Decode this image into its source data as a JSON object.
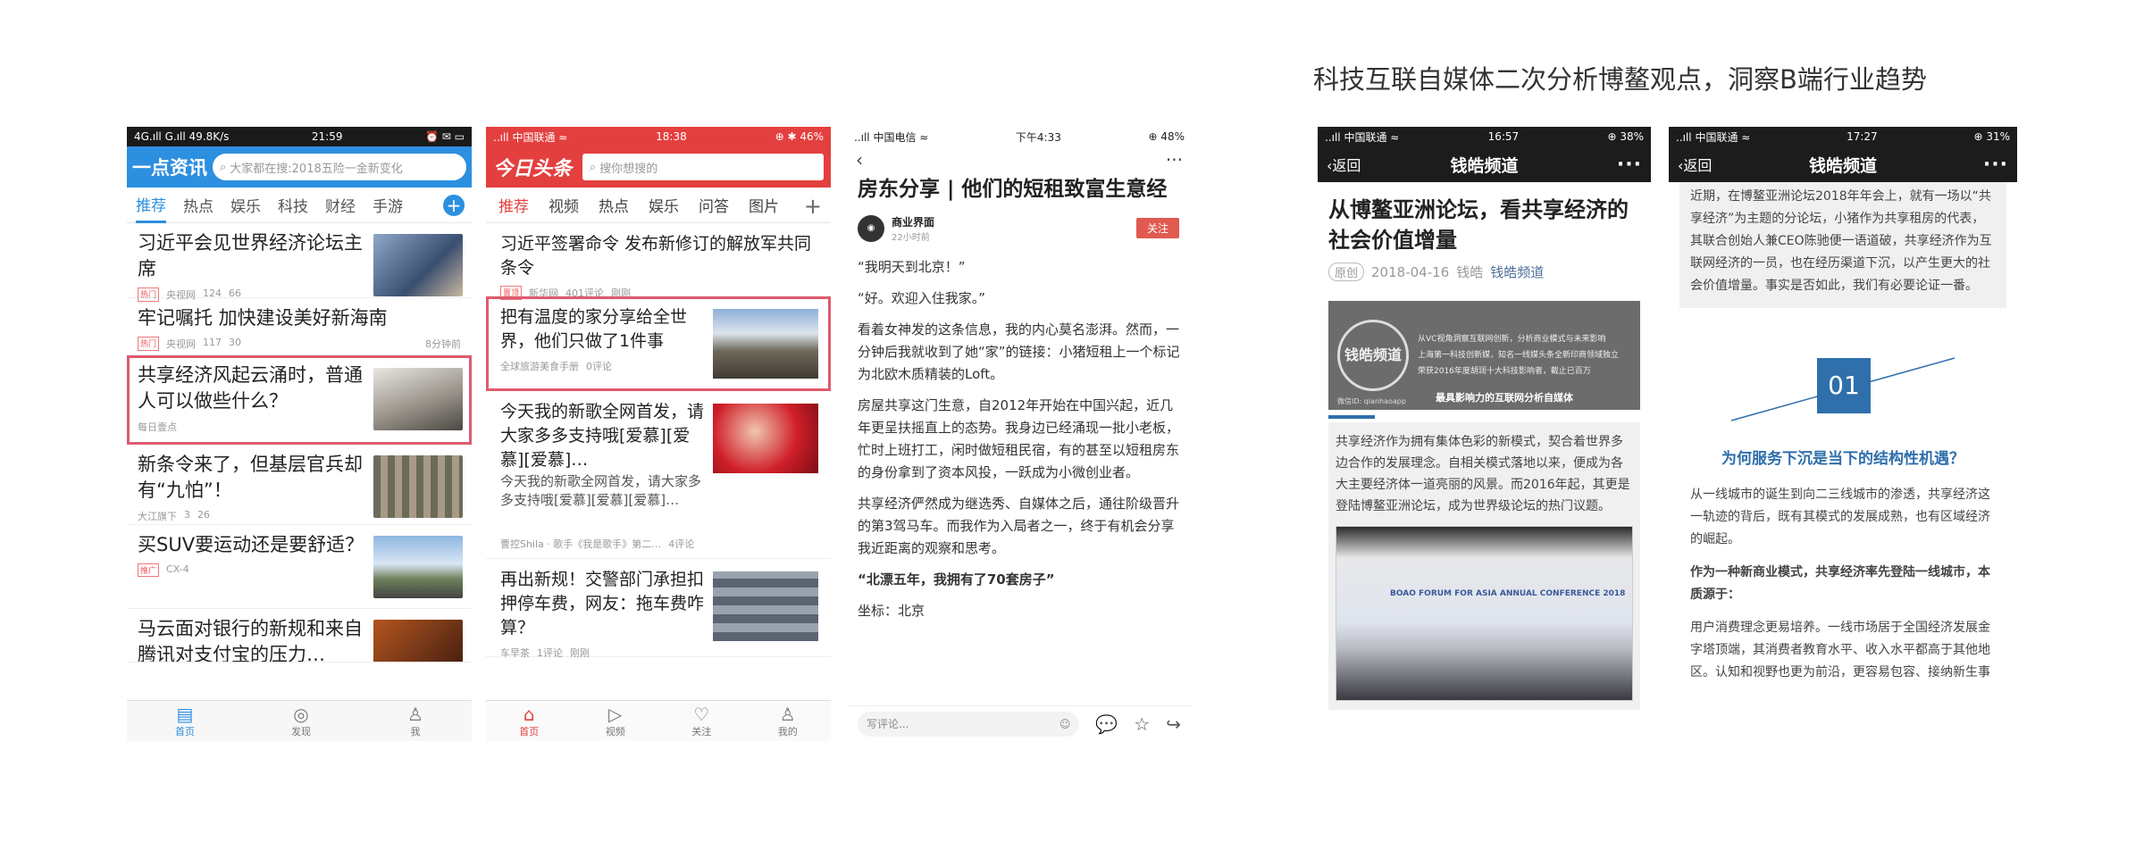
{
  "caption": "科技互联自媒体二次分析博鳌观点，洞察B端行业趋势",
  "colors": {
    "yidian_blue": "#2d8fe0",
    "toutiao_red": "#e43f3f",
    "highlight": "#e05a6e",
    "channel_blue": "#2f6fab"
  },
  "phone1": {
    "status": {
      "left": "4G.ıll G.ıll 49.8K/s",
      "time": "21:59",
      "right": "⏰ ✉ ▭"
    },
    "logo": "一点资讯",
    "search_placeholder": "大家都在搜:2018五险一金新变化",
    "tabs": [
      "推荐",
      "热点",
      "娱乐",
      "科技",
      "财经",
      "手游"
    ],
    "plus_icon": "plus-icon",
    "items": [
      {
        "title": "习近平会见世界经济论坛主席",
        "tag": "热门",
        "source": "央视网",
        "comments": "124",
        "likes": "66",
        "time": ""
      },
      {
        "title": "牢记嘱托 加快建设美好新海南",
        "tag": "热门",
        "source": "央视网",
        "comments": "117",
        "likes": "30",
        "time": "8分钟前"
      },
      {
        "title": "共享经济风起云涌时，普通人可以做些什么？",
        "tag": "",
        "source": "每日壹点",
        "comments": "",
        "likes": "",
        "time": ""
      },
      {
        "title": "新条令来了，但基层官兵却有“九怕”！",
        "tag": "",
        "source": "大江旗下",
        "comments": "3",
        "likes": "26",
        "time": ""
      },
      {
        "title": "买SUV要运动还是要舒适？",
        "tag": "推广",
        "source": "CX-4",
        "comments": "",
        "likes": "",
        "time": ""
      },
      {
        "title": "马云面对银行的新规和来自腾讯对支付宝的压力…",
        "tag": "",
        "source": "",
        "comments": "",
        "likes": "",
        "time": ""
      }
    ],
    "nav": [
      "首页",
      "发现",
      "我"
    ]
  },
  "phone2": {
    "status": {
      "left": "..ıll 中国联通 ≈",
      "time": "18:38",
      "right": "⊕ ✱ 46%"
    },
    "logo": "今日头条",
    "search_placeholder": "搜你想搜的",
    "tabs": [
      "推荐",
      "视频",
      "热点",
      "娱乐",
      "问答",
      "图片"
    ],
    "items": [
      {
        "title": "习近平签署命令 发布新修订的解放军共同条令",
        "sub": "",
        "tag": "置顶",
        "source": "新华网",
        "comments": "401评论",
        "time": "刚刚"
      },
      {
        "title": "把有温度的家分享给全世界，他们只做了1件事",
        "sub": "",
        "tag": "",
        "source": "全球旅游美食手册",
        "comments": "0评论",
        "time": ""
      },
      {
        "title": "今天我的新歌全网首发，请大家多多支持哦[爱慕][爱慕][爱慕]…",
        "sub": "今天我的新歌全网首发，请大家多多支持哦[爱慕][爱慕][爱慕]…",
        "tag": "",
        "source": "曹控Shila · 歌手《我是歌手》第二…",
        "comments": "4评论",
        "time": ""
      },
      {
        "title": "再出新规！交警部门承担扣押停车费，网友：拖车费咋算？",
        "sub": "",
        "tag": "",
        "source": "车早茶",
        "comments": "1评论",
        "time": "刚刚"
      }
    ],
    "nav": [
      "首页",
      "视频",
      "关注",
      "我的"
    ]
  },
  "phone3": {
    "status": {
      "left": "..ıll 中国电信 ≈",
      "time": "下午4:33",
      "right": "⊕ 48%"
    },
    "title": "房东分享 | 他们的短租致富生意经",
    "author": "商业界面",
    "author_time": "22小时前",
    "follow": "关注",
    "paragraphs": [
      {
        "text": "“我明天到北京！”",
        "bold": false
      },
      {
        "text": "“好。欢迎入住我家。”",
        "bold": false
      },
      {
        "text": "看着女神发的这条信息，我的内心莫名澎湃。然而，一分钟后我就收到了她“家”的链接：小猪短租上一个标记为北欧木质精装的Loft。",
        "bold": false
      },
      {
        "text": "房屋共享这门生意，自2012年开始在中国兴起，近几年更呈扶摇直上的态势。我身边已经涌现一批小老板，忙时上班打工，闲时做短租民宿，有的甚至以短租房东的身份拿到了资本风投，一跃成为小微创业者。",
        "bold": false
      },
      {
        "text": "共享经济俨然成为继选秀、自媒体之后，通往阶级晋升的第3驾马车。而我作为入局者之一，终于有机会分享我近距离的观察和思考。",
        "bold": false
      },
      {
        "text": "“北漂五年，我拥有了70套房子”",
        "bold": true
      },
      {
        "text": "坐标：北京",
        "bold": false
      }
    ],
    "comment_placeholder": "写评论..."
  },
  "phone4": {
    "status": {
      "left": "..ıll 中国联通 ≈",
      "time": "16:57",
      "right": "⊕ 38%"
    },
    "back": "返回",
    "channel": "钱皓频道",
    "title": "从博鳌亚洲论坛，看共享经济的社会价值增量",
    "original": "原创",
    "date": "2018-04-16",
    "author": "钱皓",
    "channel_link": "钱皓频道",
    "banner_logo": "钱皓频道",
    "banner_lines": [
      "从VC视角洞察互联网创新，分析商业模式与未来影响",
      "上海第一科技创新媒，知名一线媒头条全新印商领域独立",
      "荣获2016年度胡润十大科技影响者，截止已百万"
    ],
    "banner_wechat": "微信ID: qianhaoapp",
    "banner_slogan": "最具影响力的互联网分析自媒体",
    "quote": "共享经济作为拥有集体色彩的新模式，契合着世界多边合作的发展理念。自相关模式落地以来，便成为各大主要经济体一道亮丽的风景。而2016年起，其更是登陆博鳌亚洲论坛，成为世界级论坛的热门议题。",
    "photo_label": "BOAO FORUM FOR ASIA ANNUAL CONFERENCE 2018"
  },
  "phone5": {
    "status": {
      "left": "..ıll 中国联通 ≈",
      "time": "17:27",
      "right": "⊕ 31%"
    },
    "back": "返回",
    "channel": "钱皓频道",
    "quote": "近期，在博鳌亚洲论坛2018年年会上，就有一场以“共享经济”为主题的分论坛，小猪作为共享租房的代表，其联合创始人兼CEO陈驰便一语道破，共享经济作为互联网经济的一员，也在经历渠道下沉，以产生更大的社会价值增量。事实是否如此，我们有必要论证一番。",
    "number": "01",
    "section_title": "为何服务下沉是当下的结构性机遇？",
    "paragraphs": [
      {
        "text": "从一线城市的诞生到向二三线城市的渗透，共享经济这一轨迹的背后，既有其模式的发展成熟，也有区域经济的崛起。",
        "bold": false
      },
      {
        "text": "作为一种新商业模式，共享经济率先登陆一线城市，本质源于：",
        "bold": true
      },
      {
        "text": "用户消费理念更易培养。一线市场居于全国经济发展金字塔顶端，其消费者教育水平、收入水平都高于其他地区。认知和视野也更为前沿，更容易包容、接纳新生事",
        "bold": false
      }
    ]
  }
}
